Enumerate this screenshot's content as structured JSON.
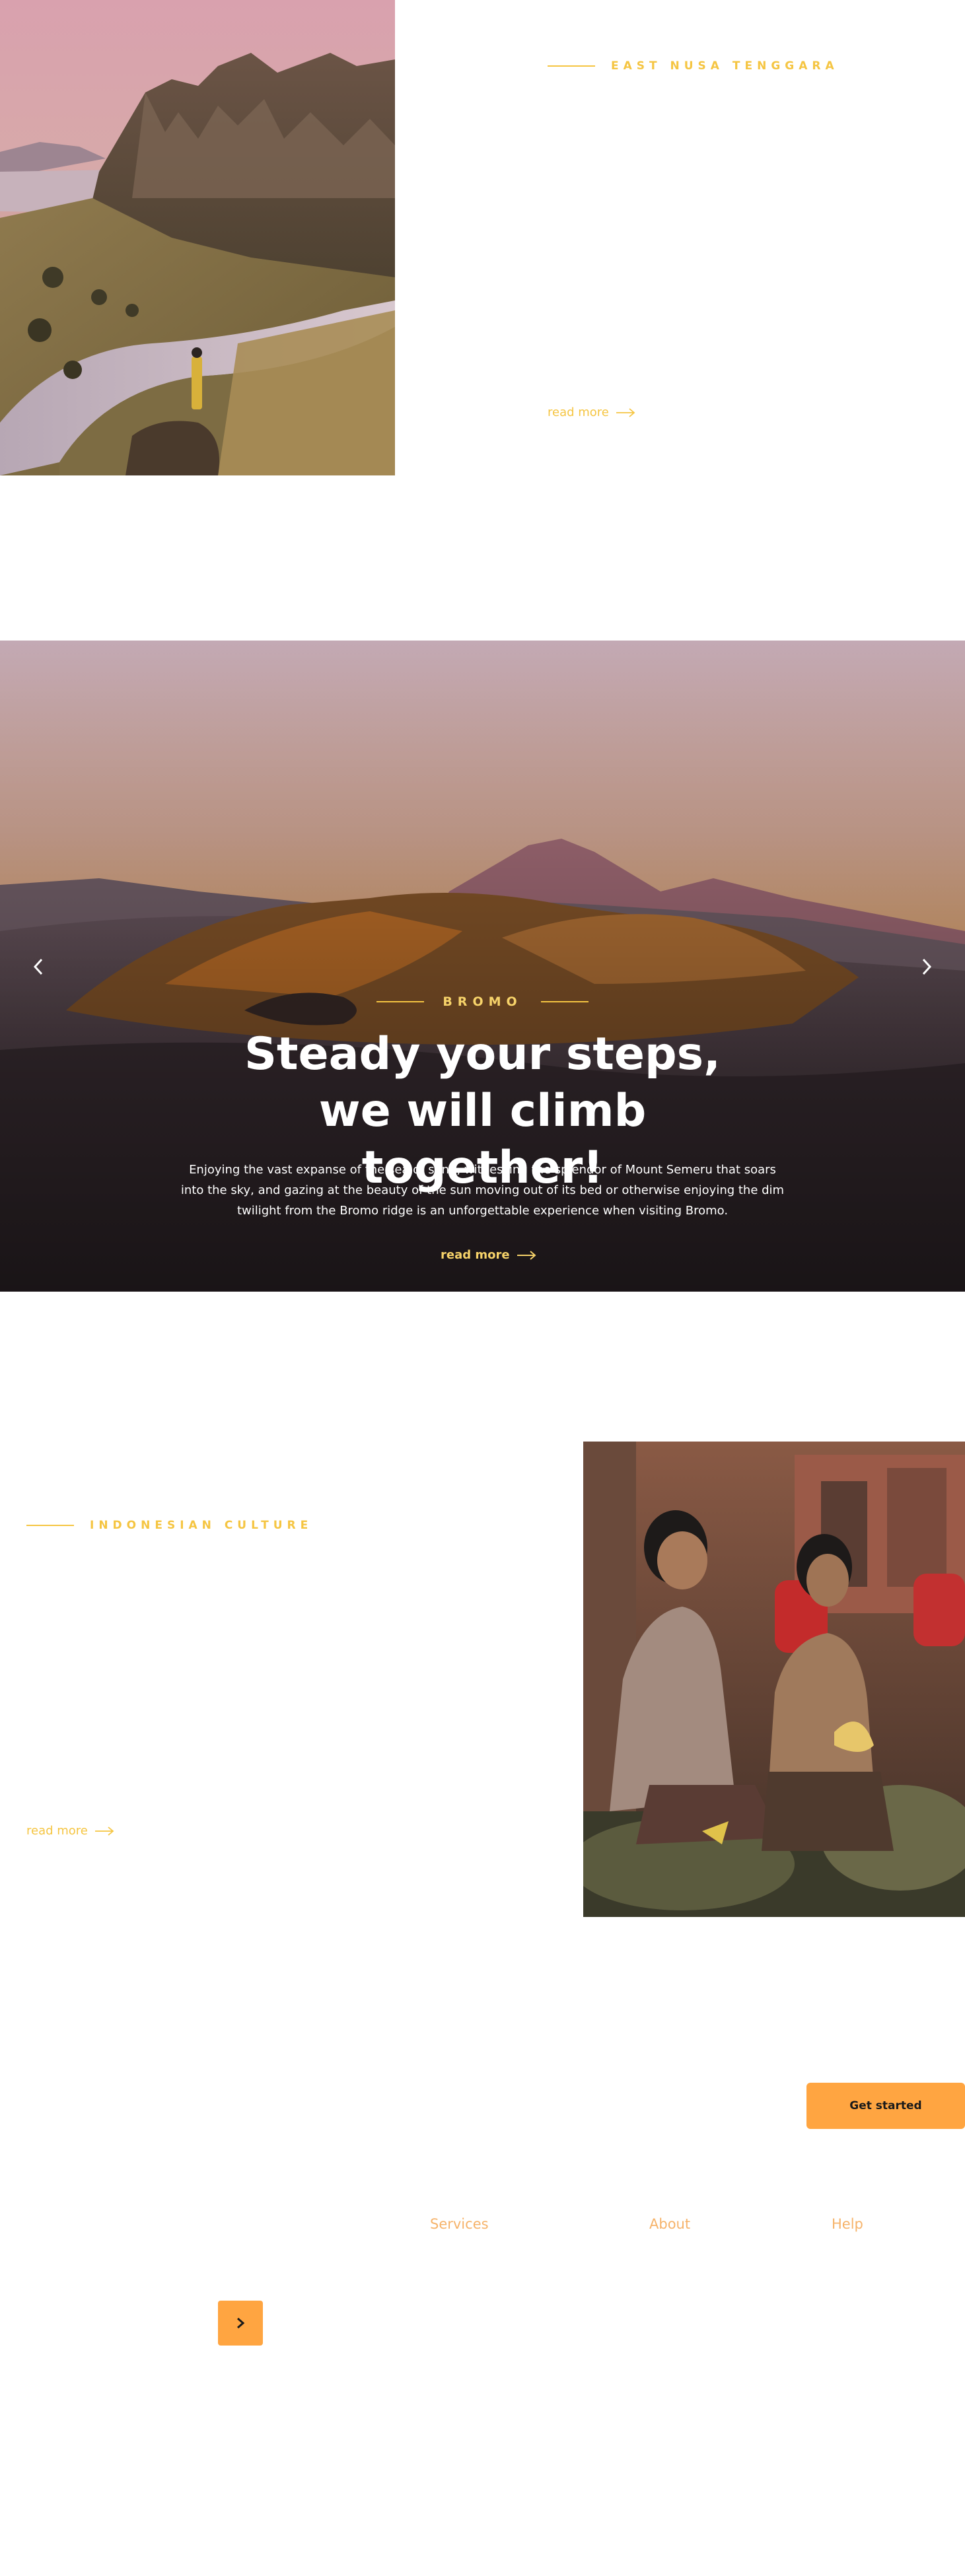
{
  "colors": {
    "accent_gold": "#f5c542",
    "accent_orange": "#ffa541",
    "nav_link": "#f6b36a",
    "background": "#ffffff"
  },
  "section_ent": {
    "eyebrow": "EAST NUSA TENGGARA",
    "read_more": "read more",
    "image_subject": "Padar island ridge with a woman in a yellow dress overlooking a bay"
  },
  "hero": {
    "eyebrow": "BROMO",
    "title": "Steady your steps, we will climb together!",
    "body": "Enjoying the vast expanse of the sea of sand, witnessing the splendor of Mount Semeru that soars into the sky, and gazing at the beauty of the sun moving out of its bed or otherwise enjoying the dim twilight from the Bromo ridge is an unforgettable experience when visiting Bromo.",
    "read_more": "read more",
    "prev_icon": "chevron-left-icon",
    "next_icon": "chevron-right-icon"
  },
  "section_culture": {
    "eyebrow": "INDONESIAN CULTURE",
    "read_more": "read more",
    "image_subject": "Two girls in traditional Balinese kebaya sitting at a temple"
  },
  "footer": {
    "cta_label": "Get started",
    "nav": [
      "Services",
      "About",
      "Help"
    ],
    "next_icon": "chevron-right-icon"
  }
}
